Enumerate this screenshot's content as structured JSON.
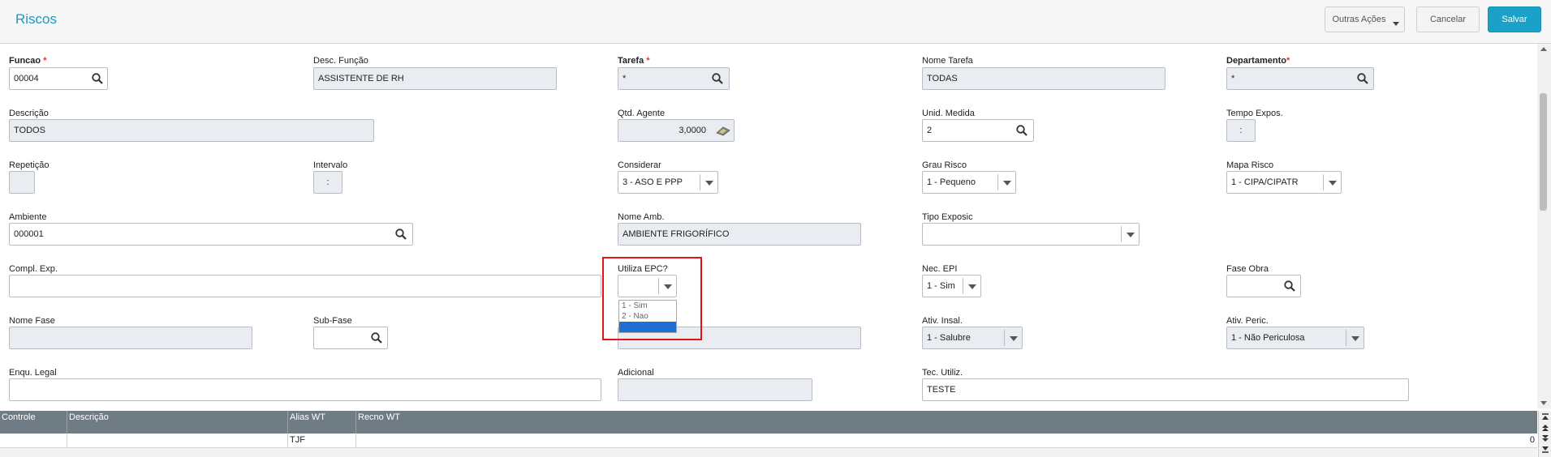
{
  "header": {
    "title": "Riscos",
    "other_actions": "Outras Ações",
    "cancel": "Cancelar",
    "save": "Salvar"
  },
  "form": {
    "funcao": {
      "label": "Funcao",
      "required": "*",
      "value": "00004"
    },
    "desc_funcao": {
      "label": "Desc. Função",
      "value": "ASSISTENTE DE RH"
    },
    "tarefa": {
      "label": "Tarefa",
      "required": "*",
      "value": "*"
    },
    "nome_tarefa": {
      "label": "Nome Tarefa",
      "value": "TODAS"
    },
    "departamento": {
      "label": "Departamento",
      "required": "*",
      "value": "*"
    },
    "descricao": {
      "label": "Descrição",
      "value": "TODOS"
    },
    "qtd_agente": {
      "label": "Qtd. Agente",
      "value": "3,0000"
    },
    "unid_medida": {
      "label": "Unid. Medida",
      "value": "2"
    },
    "tempo_expos": {
      "label": "Tempo Expos.",
      "value": ":"
    },
    "repeticao": {
      "label": "Repetição",
      "value": ""
    },
    "intervalo": {
      "label": "Intervalo",
      "value": ":"
    },
    "considerar": {
      "label": "Considerar",
      "value": "3 - ASO E PPP"
    },
    "grau_risco": {
      "label": "Grau Risco",
      "value": "1 - Pequeno"
    },
    "mapa_risco": {
      "label": "Mapa Risco",
      "value": "1 - CIPA/CIPATR"
    },
    "ambiente": {
      "label": "Ambiente",
      "value": "000001"
    },
    "nome_amb": {
      "label": "Nome Amb.",
      "value": "AMBIENTE FRIGORÍFICO"
    },
    "tipo_exposic": {
      "label": "Tipo Exposic",
      "value": ""
    },
    "compl_exp": {
      "label": "Compl. Exp.",
      "value": ""
    },
    "utiliza_epc": {
      "label": "Utiliza EPC?",
      "value": "",
      "options": [
        "1 - Sim",
        "2 - Nao",
        ""
      ]
    },
    "nec_epi": {
      "label": "Nec. EPI",
      "value": "1 - Sim"
    },
    "fase_obra": {
      "label": "Fase Obra",
      "value": ""
    },
    "nome_fase": {
      "label": "Nome Fase",
      "value": ""
    },
    "sub_fase": {
      "label": "Sub-Fase",
      "value": ""
    },
    "ativ_insal": {
      "label": "Ativ. Insal.",
      "value": "1 - Salubre"
    },
    "ativ_peric": {
      "label": "Ativ. Peric.",
      "value": "1 - Não Periculosa"
    },
    "enqu_legal": {
      "label": "Enqu. Legal",
      "value": ""
    },
    "adicional": {
      "label": "Adicional",
      "value": ""
    },
    "tec_utiliz": {
      "label": "Tec. Utiliz.",
      "value": "TESTE"
    }
  },
  "grid": {
    "columns": [
      "Controle",
      "Descrição",
      "Alias WT",
      "Recno WT"
    ],
    "rows": [
      [
        "",
        "",
        "TJF",
        ""
      ]
    ],
    "counter": "0"
  },
  "colors": {
    "accent": "#1ba1c8",
    "highlight": "#e2141a",
    "grid_header": "#6f7c84"
  }
}
